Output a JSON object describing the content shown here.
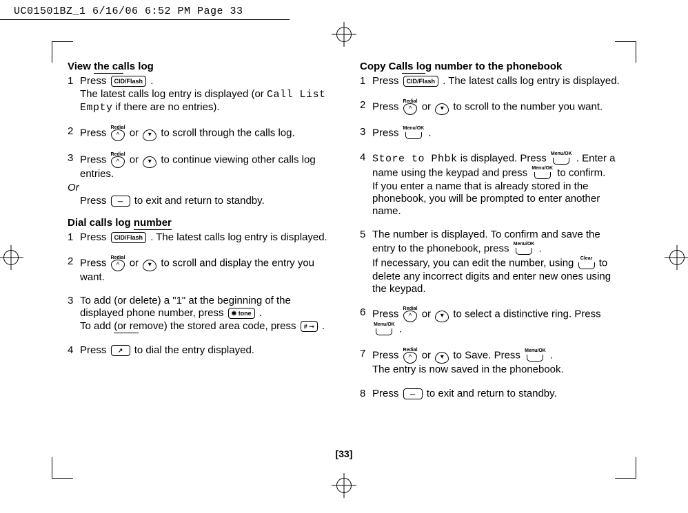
{
  "header": "UC01501BZ_1  6/16/06  6:52 PM  Page 33",
  "page_number": "[33]",
  "keys": {
    "cid_flash": "CID/Flash",
    "redial": "Redial",
    "down": "▾",
    "up": "^",
    "menu_ok": "Menu/OK",
    "clear": "Clear",
    "tone": "tone",
    "hash_key": "# ⊸",
    "talk": "⌕",
    "end": "⏚"
  },
  "left": {
    "section1_title": "View the calls log",
    "s1_1a": "Press ",
    "s1_1b": " .",
    "s1_1c_a": "The latest calls log entry is displayed (or ",
    "s1_1c_mono": "Call List Empty",
    "s1_1c_b": " if there are no entries).",
    "s1_2a": "Press ",
    "s1_2b": " or ",
    "s1_2c": " to scroll through the calls log.",
    "s1_3a": "Press ",
    "s1_3b": " or ",
    "s1_3c": " to continue viewing other calls log entries.",
    "s1_or": "Or",
    "s1_or_a": "Press ",
    "s1_or_b": " to exit and return to standby.",
    "section2_title": "Dial calls log number",
    "s2_1a": "Press ",
    "s2_1b": " . The latest calls log entry is displayed.",
    "s2_2a": "Press ",
    "s2_2b": " or ",
    "s2_2c": " to scroll and display the entry you want.",
    "s2_3a": "To add (or delete) a \"1\" at the beginning of the displayed phone number, press ",
    "s2_3b": " .",
    "s2_3c": "To add (or remove) the stored area code, press ",
    "s2_3d": " .",
    "s2_4a": "Press ",
    "s2_4b": " to dial the entry displayed."
  },
  "right": {
    "section_title": "Copy Calls log number to the phonebook",
    "r1a": "Press ",
    "r1b": " . The latest calls log entry is displayed.",
    "r2a": "Press ",
    "r2b": " or ",
    "r2c": " to scroll to the number you want.",
    "r3a": "Press ",
    "r3b": " .",
    "r4a_mono": "Store to Phbk",
    "r4a": " is displayed. Press ",
    "r4b": " . Enter a name using the keypad and press ",
    "r4c": " to confirm.",
    "r4d": "If you enter a name that is already stored in the phonebook, you will be prompted to enter another name.",
    "r5a": "The number is displayed. To confirm and save the entry to the phonebook, press ",
    "r5b": " .",
    "r5c": "If necessary, you can edit the number, using ",
    "r5d": " to delete any incorrect digits and enter new ones using the keypad.",
    "r6a": "Press ",
    "r6b": " or ",
    "r6c": " to select a distinctive ring. Press ",
    "r6d": " .",
    "r7a": "Press ",
    "r7b": " or ",
    "r7c": " to Save. Press ",
    "r7d": " .",
    "r7e": "The entry is now saved in the phonebook.",
    "r8a": "Press ",
    "r8b": " to exit and return to standby."
  }
}
